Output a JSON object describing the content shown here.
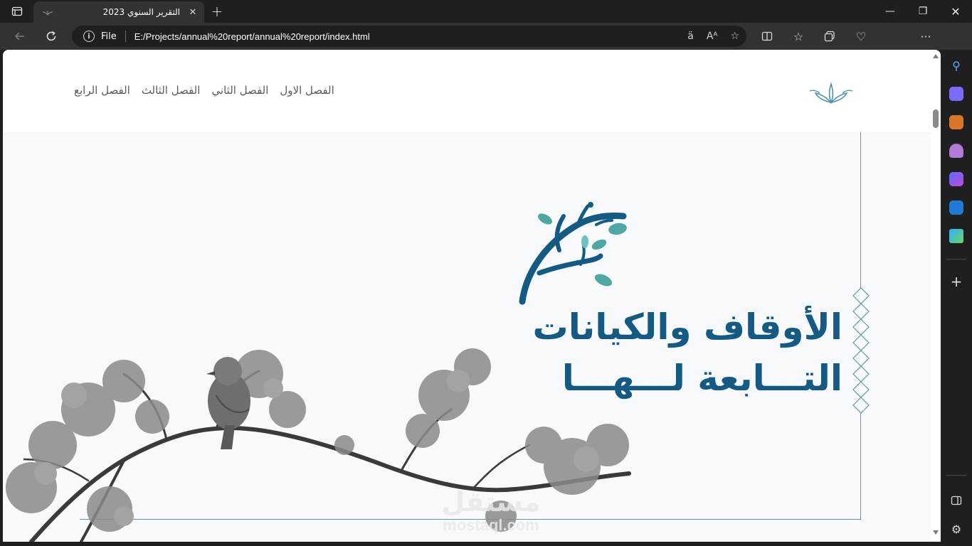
{
  "browser": {
    "tab": {
      "title": "التقرير السنوي 2023",
      "favicon": "leaf-favicon-icon"
    },
    "new_tab_label": "+",
    "address": {
      "scheme_label": "File",
      "url": "E:/Projects/annual%20report/annual%20report/index.html"
    },
    "window_controls": {
      "minimize": "—",
      "maximize": "❐",
      "close": "✕"
    }
  },
  "site": {
    "nav": [
      {
        "label": "الفصل الاول"
      },
      {
        "label": "الفصل الثاني"
      },
      {
        "label": "الفصل الثالث"
      },
      {
        "label": "الفصل الرابع"
      }
    ],
    "hero": {
      "title_line1": "الأوقاف والكيانات",
      "title_line2": "التـــابعة لـــهـــا"
    },
    "watermark": {
      "arabic": "مستقل",
      "latin": "mostaql.com"
    }
  },
  "colors": {
    "brand_primary": "#155a82",
    "brand_leaf": "#4fa7a3",
    "frame_line": "#5d9aa5",
    "hero_bg": "#f7f9fa"
  }
}
